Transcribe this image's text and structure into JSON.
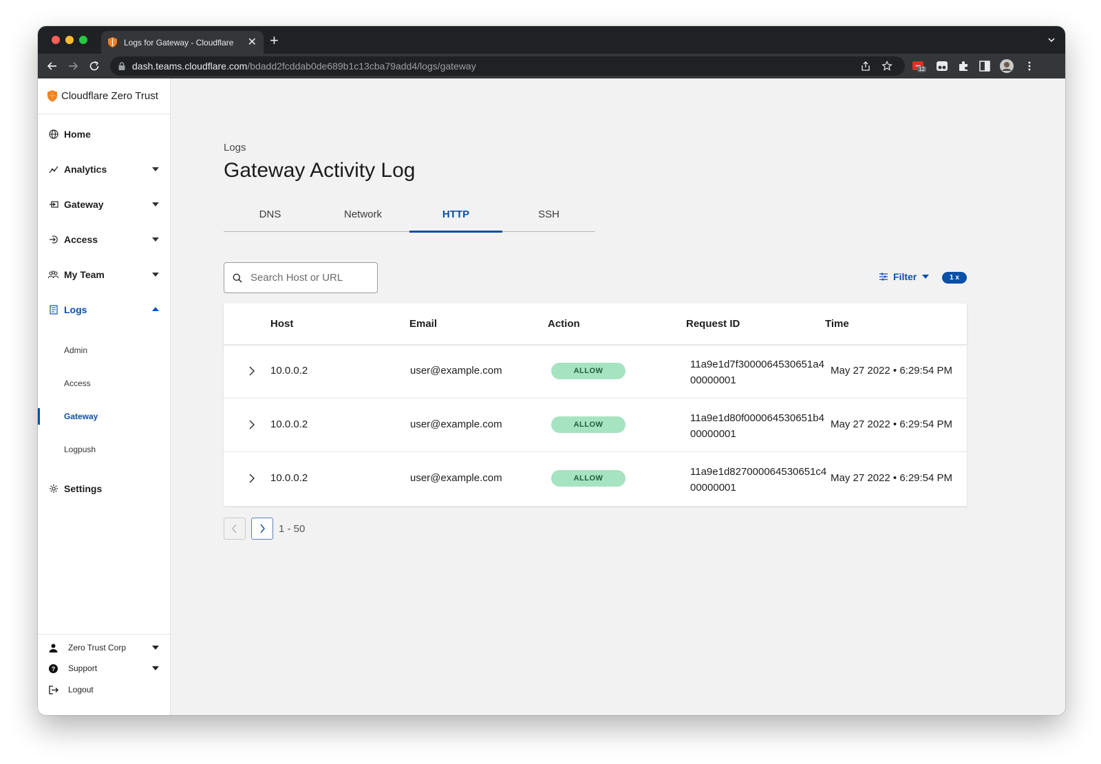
{
  "browser": {
    "tab_title": "Logs for Gateway - Cloudflare",
    "url_host": "dash.teams.cloudflare.com",
    "url_path": "/bdadd2fcddab0de689b1c13cba79add4/logs/gateway",
    "extension_badge": "12"
  },
  "brand": {
    "name": "Cloudflare Zero Trust"
  },
  "sidebar": {
    "items": [
      {
        "label": "Home",
        "icon": "globe-icon"
      },
      {
        "label": "Analytics",
        "icon": "analytics-icon"
      },
      {
        "label": "Gateway",
        "icon": "gateway-icon"
      },
      {
        "label": "Access",
        "icon": "access-icon"
      },
      {
        "label": "My Team",
        "icon": "team-icon"
      },
      {
        "label": "Logs",
        "icon": "logs-icon"
      },
      {
        "label": "Settings",
        "icon": "gear-icon"
      }
    ],
    "logs_subitems": [
      "Admin",
      "Access",
      "Gateway",
      "Logpush"
    ],
    "bottom": [
      {
        "label": "Zero Trust Corp",
        "icon": "user-icon"
      },
      {
        "label": "Support",
        "icon": "help-icon"
      },
      {
        "label": "Logout",
        "icon": "logout-icon"
      }
    ]
  },
  "page": {
    "breadcrumb": "Logs",
    "title": "Gateway Activity Log",
    "tabs": [
      "DNS",
      "Network",
      "HTTP",
      "SSH"
    ],
    "active_tab": "HTTP",
    "search_placeholder": "Search Host or URL",
    "filter_label": "Filter",
    "speed_badge": "1 x"
  },
  "table": {
    "headers": [
      "Host",
      "Email",
      "Action",
      "Request ID",
      "Time"
    ],
    "rows": [
      {
        "host": "10.0.0.2",
        "email": "user@example.com",
        "action": "ALLOW",
        "request_id": "11a9e1d7f3000064530651a400000001",
        "time": "May 27 2022 • 6:29:54 PM"
      },
      {
        "host": "10.0.0.2",
        "email": "user@example.com",
        "action": "ALLOW",
        "request_id": "11a9e1d80f000064530651b400000001",
        "time": "May 27 2022 • 6:29:54 PM"
      },
      {
        "host": "10.0.0.2",
        "email": "user@example.com",
        "action": "ALLOW",
        "request_id": "11a9e1d827000064530651c400000001",
        "time": "May 27 2022 • 6:29:54 PM"
      }
    ]
  },
  "pagination": {
    "range": "1 - 50"
  },
  "colors": {
    "accent": "#0b4fa8",
    "allow_bg": "#a6e3c0",
    "brand_orange": "#f38020"
  }
}
